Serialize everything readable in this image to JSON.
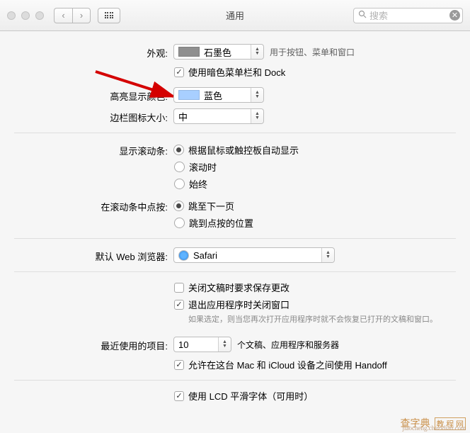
{
  "window": {
    "title": "通用"
  },
  "search": {
    "placeholder": "搜索"
  },
  "appearance": {
    "label": "外观:",
    "value": "石墨色",
    "swatch": "#8f8f8f",
    "hint": "用于按钮、菜单和窗口",
    "dark_checkbox": {
      "label": "使用暗色菜单栏和 Dock",
      "checked": true
    }
  },
  "highlight": {
    "label": "高亮显示颜色:",
    "value": "蓝色",
    "swatch": "#a8cfff"
  },
  "sidebar_size": {
    "label": "边栏图标大小:",
    "value": "中"
  },
  "scrollbars": {
    "label": "显示滚动条:",
    "options": [
      "根据鼠标或触控板自动显示",
      "滚动时",
      "始终"
    ],
    "selected": 0
  },
  "scroll_click": {
    "label": "在滚动条中点按:",
    "options": [
      "跳至下一页",
      "跳到点按的位置"
    ],
    "selected": 0
  },
  "browser": {
    "label": "默认 Web 浏览器:",
    "value": "Safari"
  },
  "close_docs": {
    "label": "关闭文稿时要求保存更改",
    "checked": false
  },
  "quit_close": {
    "label": "退出应用程序时关闭窗口",
    "checked": true,
    "helper": "如果选定，则当您再次打开应用程序时就不会恢复已打开的文稿和窗口。"
  },
  "recent": {
    "label": "最近使用的项目:",
    "value": "10",
    "suffix": "个文稿、应用程序和服务器"
  },
  "handoff": {
    "label": "允许在这台 Mac 和 iCloud 设备之间使用 Handoff",
    "checked": true
  },
  "lcd": {
    "label": "使用 LCD 平滑字体（可用时）",
    "checked": true
  },
  "watermark": {
    "main": "查字典",
    "tag": "教 程 网",
    "sub": "jiaocheng.chazidian.com"
  }
}
